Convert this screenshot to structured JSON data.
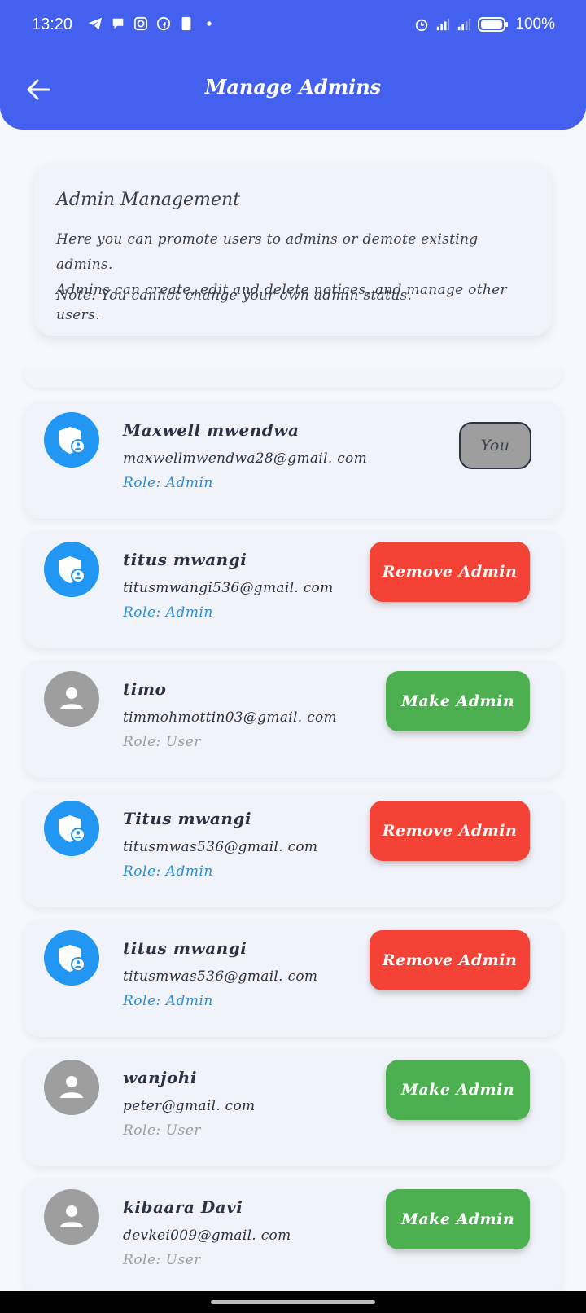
{
  "status_bar": {
    "time": "13:20",
    "battery": "100%",
    "left_icons": [
      "telegram-icon",
      "chat-icon",
      "instagram-icon",
      "facebook-icon",
      "sim-icon",
      "dot-icon"
    ],
    "right_icons": [
      "alarm-icon",
      "signal-icon",
      "signal-icon",
      "battery-icon"
    ]
  },
  "app_bar": {
    "title": "Manage Admins",
    "back_icon": "arrow-left-icon"
  },
  "info_card": {
    "title": "Admin Management",
    "line1": "Here you can promote users to admins or demote existing admins.",
    "line2": "Admins can create, edit and delete notices, and manage other users.",
    "note": "Note: You cannot change your own admin status."
  },
  "users": [
    {
      "name": "Maxwell mwendwa",
      "email": "maxwellmwendwa28@gmail. com",
      "role": "Role: Admin",
      "type": "admin",
      "action": "You",
      "action_type": "you"
    },
    {
      "name": "titus mwangi",
      "email": "titusmwangi536@gmail. com",
      "role": "Role: Admin",
      "type": "admin",
      "action": "Remove Admin",
      "action_type": "remove"
    },
    {
      "name": "timo",
      "email": "timmohmottin03@gmail. com",
      "role": "Role: User",
      "type": "user",
      "action": "Make Admin",
      "action_type": "make"
    },
    {
      "name": "Titus mwangi",
      "email": "titusmwas536@gmail. com",
      "role": "Role: Admin",
      "type": "admin",
      "action": "Remove Admin",
      "action_type": "remove"
    },
    {
      "name": "titus mwangi",
      "email": "titusmwas536@gmail. com",
      "role": "Role: Admin",
      "type": "admin",
      "action": "Remove Admin",
      "action_type": "remove"
    },
    {
      "name": "wanjohi",
      "email": "peter@gmail. com",
      "role": "Role: User",
      "type": "user",
      "action": "Make Admin",
      "action_type": "make"
    },
    {
      "name": "kibaara Davi",
      "email": "devkei009@gmail. com",
      "role": "Role: User",
      "type": "user",
      "action": "Make Admin",
      "action_type": "make"
    }
  ],
  "colors": {
    "primary": "#4361ee",
    "admin_avatar": "#2196f3",
    "user_avatar": "#9e9e9e",
    "remove": "#f44336",
    "make": "#4caf50"
  }
}
